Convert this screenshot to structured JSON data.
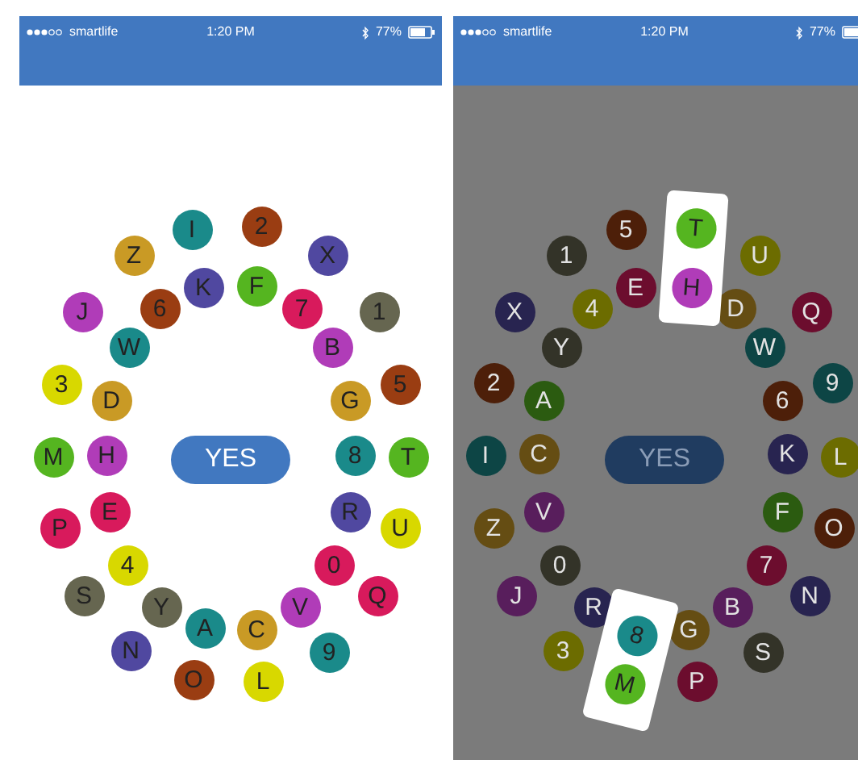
{
  "screens": [
    {
      "status_bar": {
        "carrier": "smartlife",
        "time": "1:20 PM",
        "battery": "77%"
      },
      "dimmed": false,
      "button": "YES",
      "tokens": [
        {
          "label": "I",
          "color": "#1a8a8a"
        },
        {
          "label": "2",
          "color": "#9a3d12"
        },
        {
          "label": "Z",
          "color": "#c99a25"
        },
        {
          "label": "X",
          "color": "#5048a0"
        },
        {
          "label": "K",
          "color": "#5048a0"
        },
        {
          "label": "F",
          "color": "#55b520"
        },
        {
          "label": "J",
          "color": "#b03cb8"
        },
        {
          "label": "6",
          "color": "#9a3d12"
        },
        {
          "label": "7",
          "color": "#d81a5c"
        },
        {
          "label": "1",
          "color": "#666650"
        },
        {
          "label": "W",
          "color": "#1a8a8a"
        },
        {
          "label": "B",
          "color": "#b03cb8"
        },
        {
          "label": "3",
          "color": "#d8d800"
        },
        {
          "label": "D",
          "color": "#c99a25"
        },
        {
          "label": "G",
          "color": "#c99a25"
        },
        {
          "label": "5",
          "color": "#9a3d12"
        },
        {
          "label": "M",
          "color": "#55b520"
        },
        {
          "label": "H",
          "color": "#b03cb8"
        },
        {
          "label": "8",
          "color": "#1a8a8a"
        },
        {
          "label": "T",
          "color": "#55b520"
        },
        {
          "label": "P",
          "color": "#d81a5c"
        },
        {
          "label": "E",
          "color": "#d81a5c"
        },
        {
          "label": "R",
          "color": "#5048a0"
        },
        {
          "label": "U",
          "color": "#d8d800"
        },
        {
          "label": "4",
          "color": "#d8d800"
        },
        {
          "label": "0",
          "color": "#d81a5c"
        },
        {
          "label": "S",
          "color": "#666650"
        },
        {
          "label": "Y",
          "color": "#666650"
        },
        {
          "label": "V",
          "color": "#b03cb8"
        },
        {
          "label": "Q",
          "color": "#d81a5c"
        },
        {
          "label": "A",
          "color": "#1a8a8a"
        },
        {
          "label": "C",
          "color": "#c99a25"
        },
        {
          "label": "N",
          "color": "#5048a0"
        },
        {
          "label": "9",
          "color": "#1a8a8a"
        },
        {
          "label": "O",
          "color": "#9a3d12"
        },
        {
          "label": "L",
          "color": "#d8d800"
        }
      ]
    },
    {
      "status_bar": {
        "carrier": "smartlife",
        "time": "1:20 PM",
        "battery": "77%"
      },
      "dimmed": true,
      "button": "YES",
      "tokens": [
        {
          "label": "5",
          "color": "#4d1f09"
        },
        {
          "label": "1",
          "color": "#333328"
        },
        {
          "label": "U",
          "color": "#6c6c00"
        },
        {
          "label": "E",
          "color": "#6c0d2e"
        },
        {
          "label": "X",
          "color": "#282450"
        },
        {
          "label": "4",
          "color": "#6c6c00"
        },
        {
          "label": "D",
          "color": "#654d13"
        },
        {
          "label": "Q",
          "color": "#6c0d2e"
        },
        {
          "label": "Y",
          "color": "#333328"
        },
        {
          "label": "W",
          "color": "#0d4545"
        },
        {
          "label": "2",
          "color": "#4d1f09"
        },
        {
          "label": "A",
          "color": "#2b5b10"
        },
        {
          "label": "6",
          "color": "#4d1f09"
        },
        {
          "label": "9",
          "color": "#0d4545"
        },
        {
          "label": "I",
          "color": "#0d4545"
        },
        {
          "label": "C",
          "color": "#654d13"
        },
        {
          "label": "K",
          "color": "#282450"
        },
        {
          "label": "L",
          "color": "#6c6c00"
        },
        {
          "label": "Z",
          "color": "#654d13"
        },
        {
          "label": "V",
          "color": "#581e5c"
        },
        {
          "label": "F",
          "color": "#2b5b10"
        },
        {
          "label": "O",
          "color": "#4d1f09"
        },
        {
          "label": "0",
          "color": "#333328"
        },
        {
          "label": "7",
          "color": "#6c0d2e"
        },
        {
          "label": "J",
          "color": "#581e5c"
        },
        {
          "label": "R",
          "color": "#282450"
        },
        {
          "label": "B",
          "color": "#581e5c"
        },
        {
          "label": "N",
          "color": "#282450"
        },
        {
          "label": "G",
          "color": "#654d13"
        },
        {
          "label": "3",
          "color": "#6c6c00"
        },
        {
          "label": "S",
          "color": "#333328"
        },
        {
          "label": "P",
          "color": "#6c0d2e"
        }
      ],
      "cards": [
        {
          "tokens": [
            {
              "label": "T",
              "color": "#55b520"
            },
            {
              "label": "H",
              "color": "#b03cb8"
            }
          ]
        },
        {
          "tokens": [
            {
              "label": "8",
              "color": "#1a8a8a"
            },
            {
              "label": "M",
              "color": "#55b520"
            }
          ]
        }
      ]
    }
  ]
}
